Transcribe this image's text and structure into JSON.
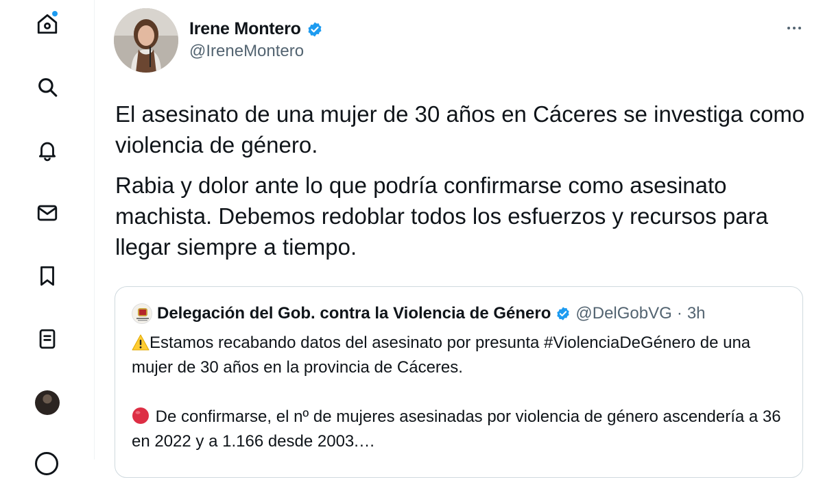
{
  "nav": {
    "items": [
      {
        "name": "home",
        "icon": "home-icon",
        "badge": true
      },
      {
        "name": "explore",
        "icon": "search-icon"
      },
      {
        "name": "notifications",
        "icon": "bell-icon"
      },
      {
        "name": "messages",
        "icon": "envelope-icon"
      },
      {
        "name": "bookmarks",
        "icon": "bookmark-icon"
      },
      {
        "name": "lists",
        "icon": "lists-icon"
      },
      {
        "name": "profile",
        "icon": "avatar"
      }
    ],
    "accent_color": "#1d9bf0"
  },
  "tweet": {
    "author_name": "Irene Montero",
    "author_handle": "@IreneMontero",
    "verified": true,
    "paragraphs": [
      "El asesinato de una mujer de 30 años en Cáceres se investiga como violencia de género.",
      "Rabia y dolor ante lo que podría confirmarse como asesinato machista. Debemos redoblar todos los esfuerzos y recursos para llegar siempre a tiempo."
    ]
  },
  "quote": {
    "author_name": "Delegación del Gob. contra la Violencia de Género",
    "verified": true,
    "author_handle": "@DelGobVG",
    "separator": "·",
    "time": "3h",
    "line1_text": "Estamos recabando datos del asesinato por presunta #ViolenciaDeGénero de una mujer de 30 años en la provincia de Cáceres.",
    "line1_icon": "warning-icon",
    "line2_text": "De confirmarse, el nº de mujeres asesinadas por violencia de género ascendería a 36 en 2022 y a 1.166 desde 2003.…",
    "line2_icon": "red-circle-icon"
  }
}
